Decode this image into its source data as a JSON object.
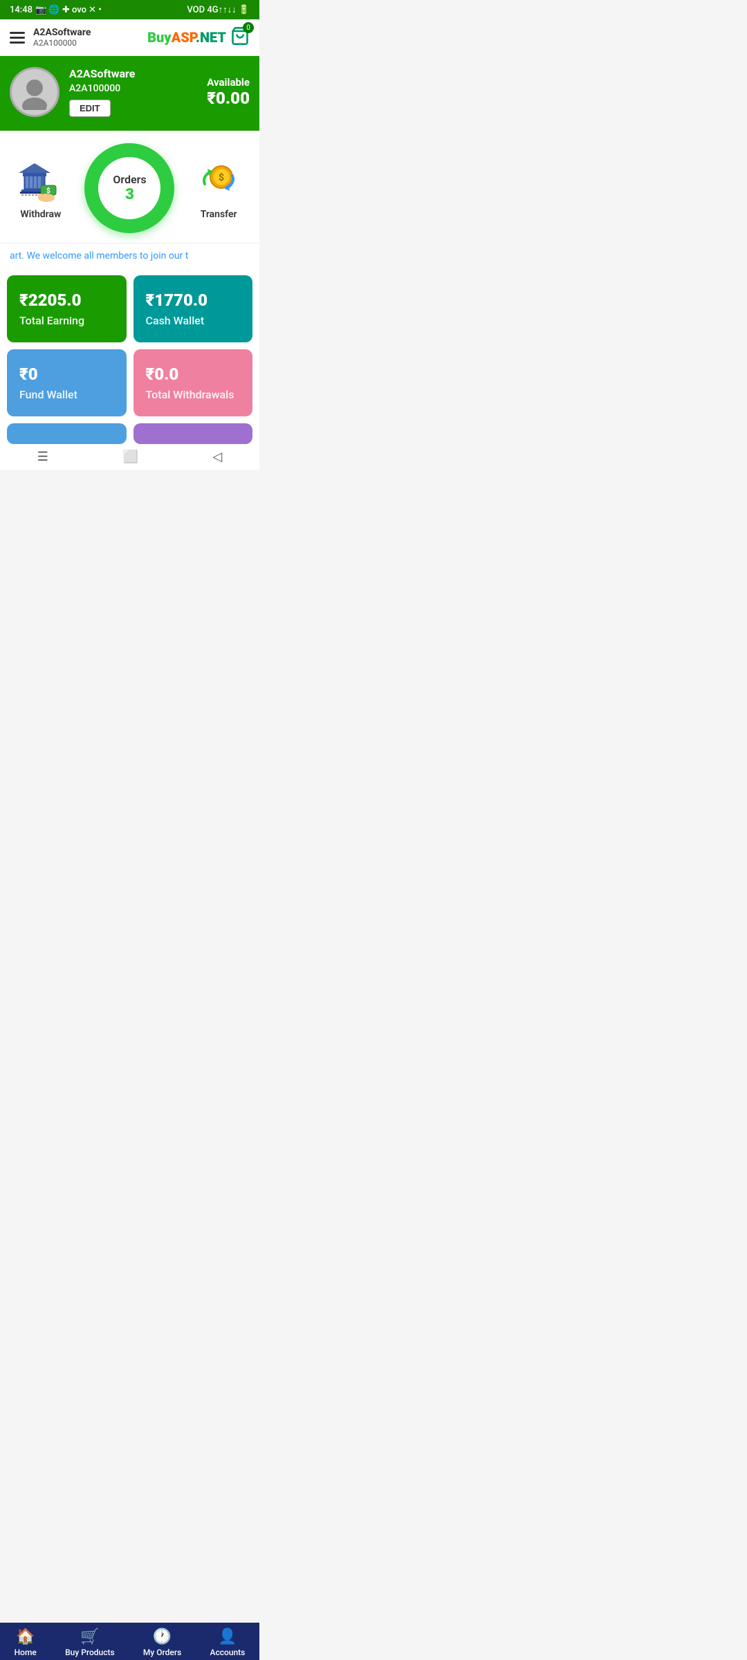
{
  "statusBar": {
    "time": "14:48",
    "battery": "🔋",
    "signal": "4G"
  },
  "header": {
    "menuIcon": "☰",
    "userName": "A2ASoftware",
    "userId": "A2A100000",
    "logoText": {
      "buy": "Buy",
      "asp": "ASP",
      "dot": ".",
      "net": "NET"
    },
    "cartCount": "0"
  },
  "profile": {
    "name": "A2ASoftware",
    "id": "A2A100000",
    "editLabel": "EDIT",
    "availableLabel": "Available",
    "availableAmount": "₹0.00"
  },
  "actions": {
    "withdrawLabel": "Withdraw",
    "ordersLabel": "Orders",
    "ordersCount": "3",
    "transferLabel": "Transfer"
  },
  "welcomeText": "art. We welcome all members to join our t",
  "stats": [
    {
      "amount": "₹2205.0",
      "label": "Total Earning",
      "color": "green"
    },
    {
      "amount": "₹1770.0",
      "label": "Cash Wallet",
      "color": "teal"
    },
    {
      "amount": "₹0",
      "label": "Fund Wallet",
      "color": "blue"
    },
    {
      "amount": "₹0.0",
      "label": "Total Withdrawals",
      "color": "pink"
    }
  ],
  "bottomNav": [
    {
      "icon": "🏠",
      "label": "Home"
    },
    {
      "icon": "🛒",
      "label": "Buy Products"
    },
    {
      "icon": "🕐",
      "label": "My Orders"
    },
    {
      "icon": "👤",
      "label": "Accounts"
    }
  ]
}
